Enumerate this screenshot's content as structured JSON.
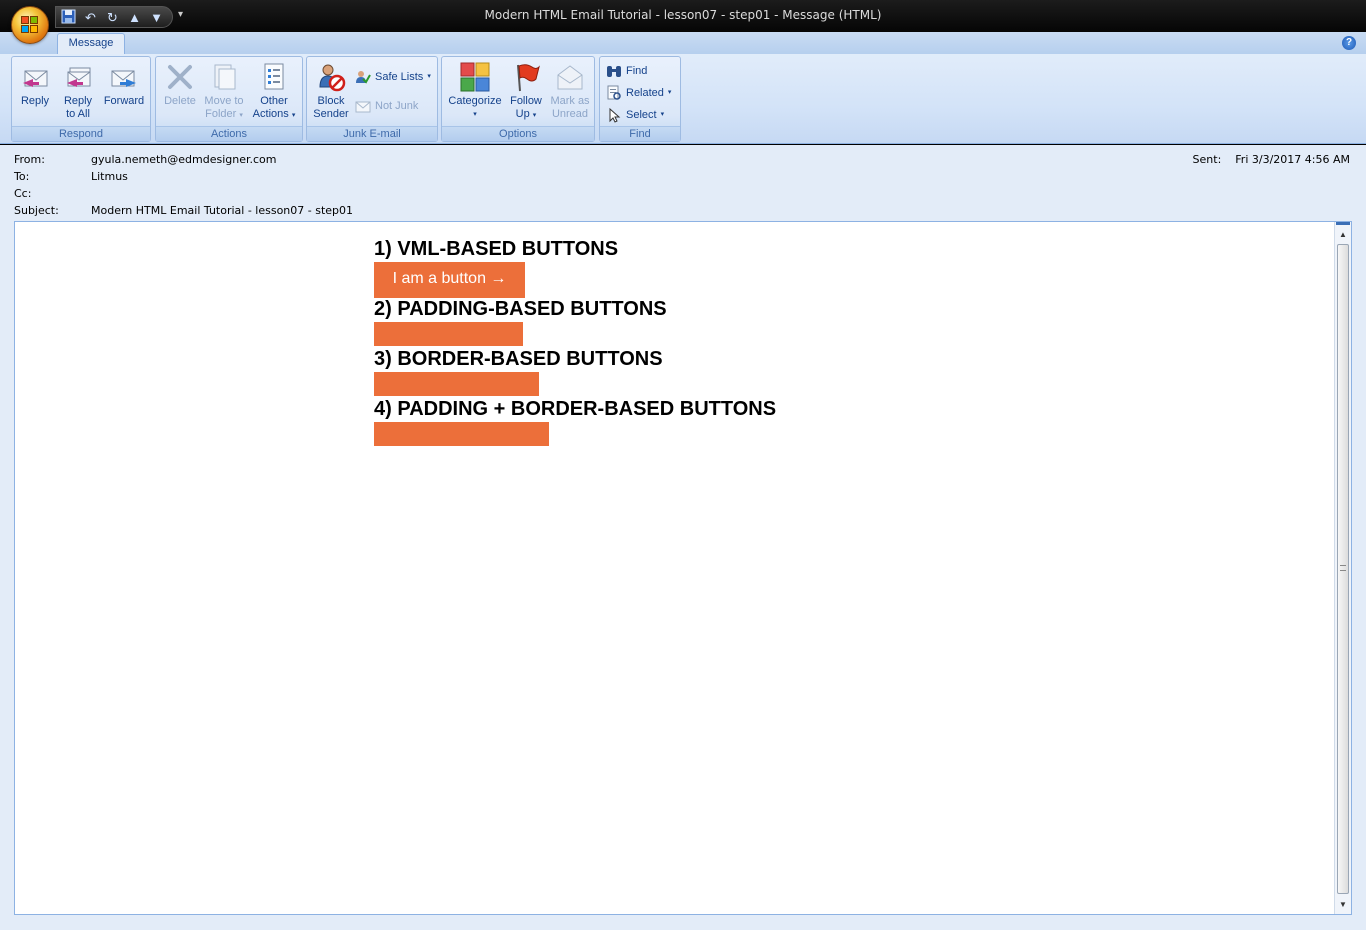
{
  "window": {
    "title": "Modern HTML Email Tutorial - lesson07 - step01  -  Message (HTML)"
  },
  "tabs": {
    "message": "Message"
  },
  "ribbon": {
    "respond": {
      "label": "Respond",
      "reply": "Reply",
      "reply_all_1": "Reply",
      "reply_all_2": "to All",
      "forward": "Forward"
    },
    "actions": {
      "label": "Actions",
      "delete": "Delete",
      "move_1": "Move to",
      "move_2": "Folder",
      "other_1": "Other",
      "other_2": "Actions"
    },
    "junk": {
      "label": "Junk E-mail",
      "block_1": "Block",
      "block_2": "Sender",
      "safe_lists": "Safe Lists",
      "not_junk": "Not Junk"
    },
    "options": {
      "label": "Options",
      "categorize": "Categorize",
      "follow_1": "Follow",
      "follow_2": "Up",
      "mark_1": "Mark as",
      "mark_2": "Unread"
    },
    "find": {
      "label": "Find",
      "find": "Find",
      "related": "Related",
      "select": "Select"
    }
  },
  "header": {
    "from_label": "From:",
    "from": "gyula.nemeth@edmdesigner.com",
    "to_label": "To:",
    "to": "Litmus",
    "cc_label": "Cc:",
    "cc": "",
    "subject_label": "Subject:",
    "subject": "Modern HTML Email Tutorial - lesson07 - step01",
    "sent_label": "Sent:",
    "sent": "Fri 3/3/2017 4:56 AM"
  },
  "email": {
    "heading1": "1) VML-BASED BUTTONS",
    "button1": "I am a button →",
    "heading2": "2) PADDING-BASED BUTTONS",
    "heading3": "3) BORDER-BASED BUTTONS",
    "heading4": "4) PADDING + BORDER-BASED BUTTONS",
    "button_color": "#ec6f3a"
  }
}
